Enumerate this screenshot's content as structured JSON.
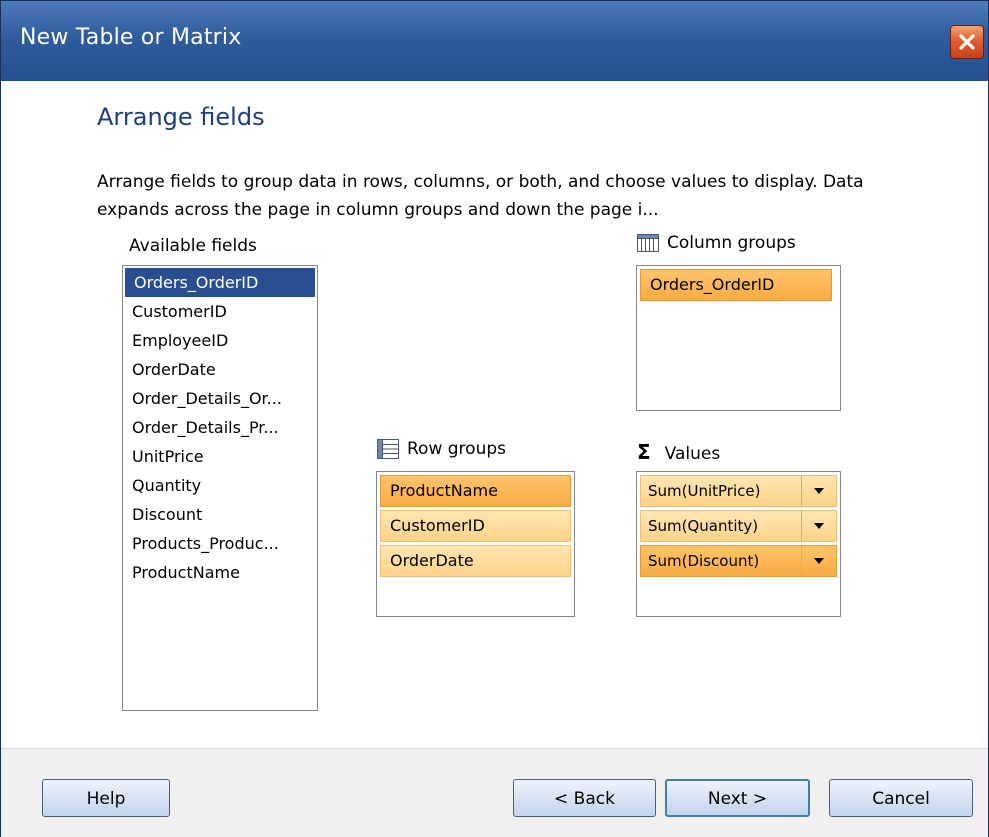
{
  "window": {
    "title": "New Table or Matrix"
  },
  "page": {
    "section_title": "Arrange fields",
    "description": "Arrange fields to group data in rows, columns, or both, and choose values to display. Data expands across the page in column groups and down the page i..."
  },
  "available_fields": {
    "label": "Available fields",
    "selected": "Orders_OrderID",
    "items": [
      "Orders_OrderID",
      "CustomerID",
      "EmployeeID",
      "OrderDate",
      "Order_Details_Or...",
      "Order_Details_Pr...",
      "UnitPrice",
      "Quantity",
      "Discount",
      "Products_Produc...",
      "ProductName"
    ]
  },
  "column_groups": {
    "label": "Column groups",
    "icon": "table-columns-icon",
    "items": [
      "Orders_OrderID"
    ]
  },
  "row_groups": {
    "label": "Row groups",
    "icon": "table-rows-icon",
    "items": [
      "ProductName",
      "CustomerID",
      "OrderDate"
    ]
  },
  "values": {
    "label": "Values",
    "icon": "sigma-icon",
    "icon_glyph": "Σ",
    "items": [
      "Sum(UnitPrice)",
      "Sum(Quantity)",
      "Sum(Discount)"
    ]
  },
  "buttons": {
    "help": "Help",
    "back": "< Back",
    "next": "Next >",
    "cancel": "Cancel"
  },
  "colors": {
    "titlebar": "#2f5c9e",
    "selection": "#2a4f91",
    "group_item": "#ffd388",
    "group_item_hot": "#f9ab43",
    "heading": "#1d3f7a"
  }
}
